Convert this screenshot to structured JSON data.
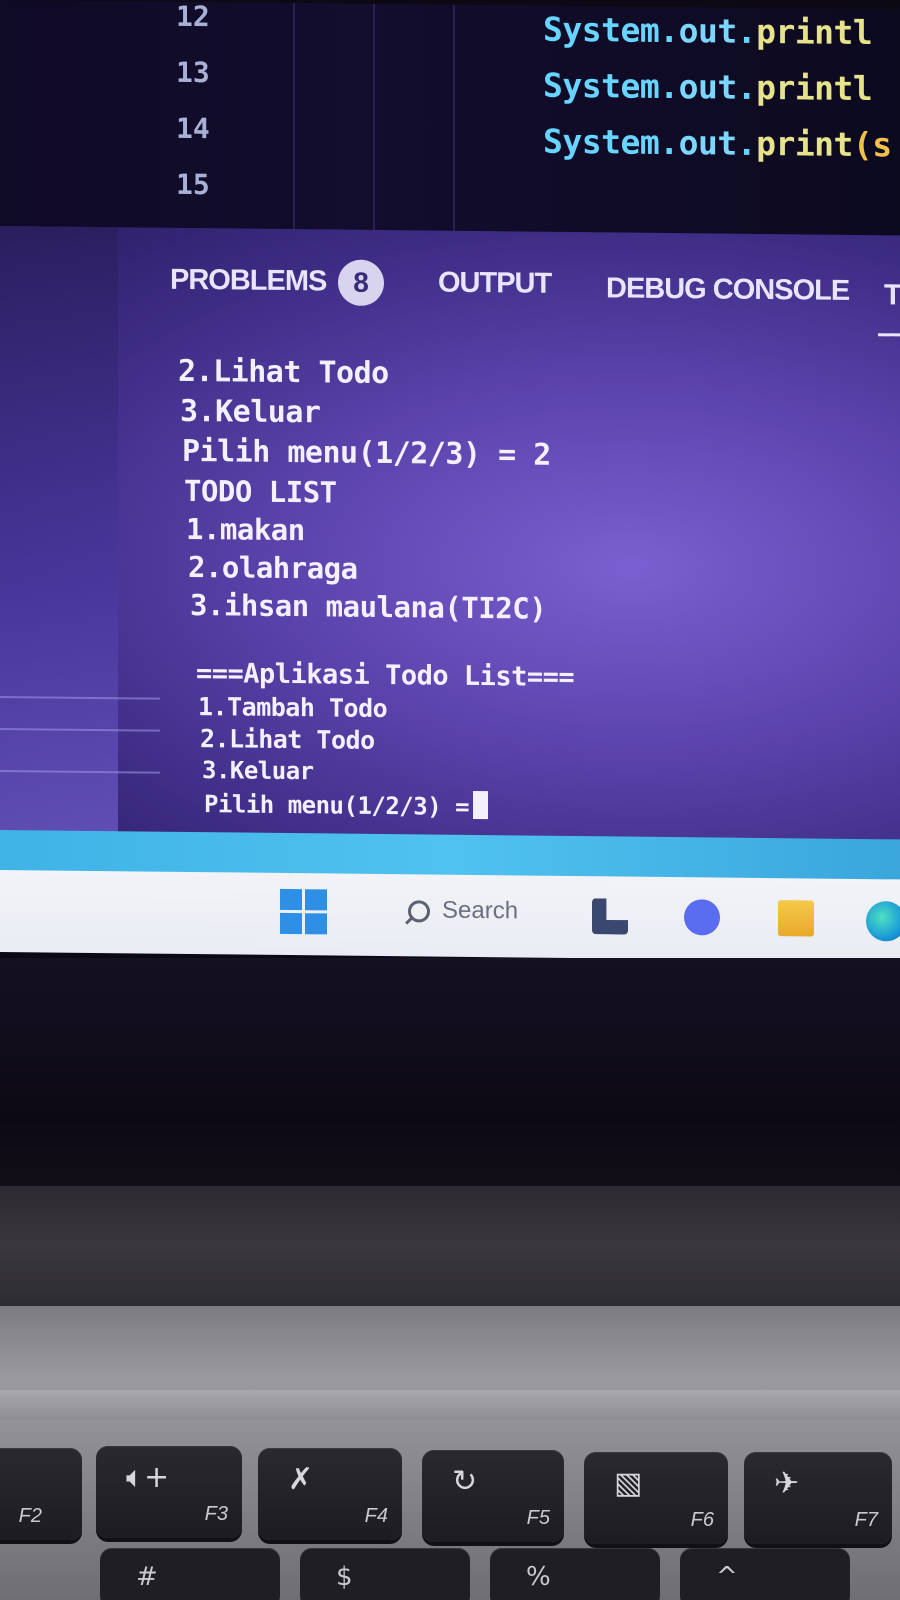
{
  "editor": {
    "line_numbers": [
      "12",
      "13",
      "14",
      "15"
    ],
    "code_lines": [
      {
        "obj": "System",
        "dot1": ".",
        "field": "out",
        "dot2": ".",
        "method": "printl",
        "tail": ""
      },
      {
        "obj": "System",
        "dot1": ".",
        "field": "out",
        "dot2": ".",
        "method": "printl",
        "tail": ""
      },
      {
        "obj": "System",
        "dot1": ".",
        "field": "out",
        "dot2": ".",
        "method": "print",
        "tail": "(s"
      }
    ]
  },
  "panel": {
    "tabs": {
      "problems": "PROBLEMS",
      "problems_count": "8",
      "output": "OUTPUT",
      "debug_console": "DEBUG CONSOLE",
      "terminal_partial": "T"
    },
    "terminal": {
      "lines": [
        "2.Lihat Todo",
        "3.Keluar",
        "Pilih menu(1/2/3) = 2",
        "TODO LIST",
        "1.makan",
        "2.olahraga",
        "3.ihsan maulana(TI2C)",
        "===Aplikasi Todo List===",
        "1.Tambah Todo",
        "2.Lihat Todo",
        "3.Keluar"
      ],
      "prompt": "Pilih menu(1/2/3) ="
    }
  },
  "taskbar": {
    "search_placeholder": "Search",
    "apps": [
      "start-icon",
      "search-icon",
      "task-view-icon",
      "chat-icon",
      "file-explorer-icon",
      "edge-icon"
    ]
  },
  "keyboard": {
    "fkeys": [
      {
        "label": "F2",
        "icon": ""
      },
      {
        "label": "F3",
        "icon": "volume-up-icon"
      },
      {
        "label": "F4",
        "icon": "mic-mute-icon"
      },
      {
        "label": "F5",
        "icon": "refresh-icon"
      },
      {
        "label": "F6",
        "icon": "display-icon"
      },
      {
        "label": "F7",
        "icon": "airplane-icon"
      }
    ],
    "number_row_partial": [
      "#",
      "$",
      "%",
      "^"
    ]
  }
}
